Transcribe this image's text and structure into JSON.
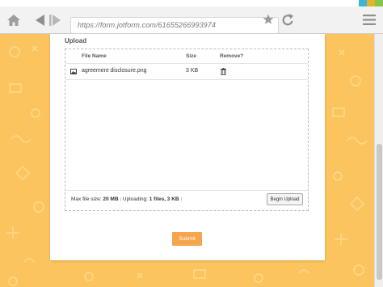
{
  "browser": {
    "url": "https://form.jotform.com/61655266993974",
    "window_control_colors": [
      "#3fb4d8",
      "#e0b52d",
      "#8bc34a"
    ]
  },
  "form": {
    "section_label": "Upload",
    "table": {
      "headers": {
        "name": "File Name",
        "size": "Size",
        "remove": "Remove?"
      },
      "files": [
        {
          "name": "agreement disclosure.png",
          "size": "3 KB"
        }
      ]
    },
    "status": {
      "max_label": "Max file size:",
      "max_value": "20 MB",
      "uploading_label": "Uploading:",
      "uploading_value": "1 files, 3 KB"
    },
    "begin_upload_label": "Begin Upload",
    "submit_label": "Submit",
    "colors": {
      "page_background": "#fbc45e",
      "submit_button": "#f6a54c"
    }
  }
}
